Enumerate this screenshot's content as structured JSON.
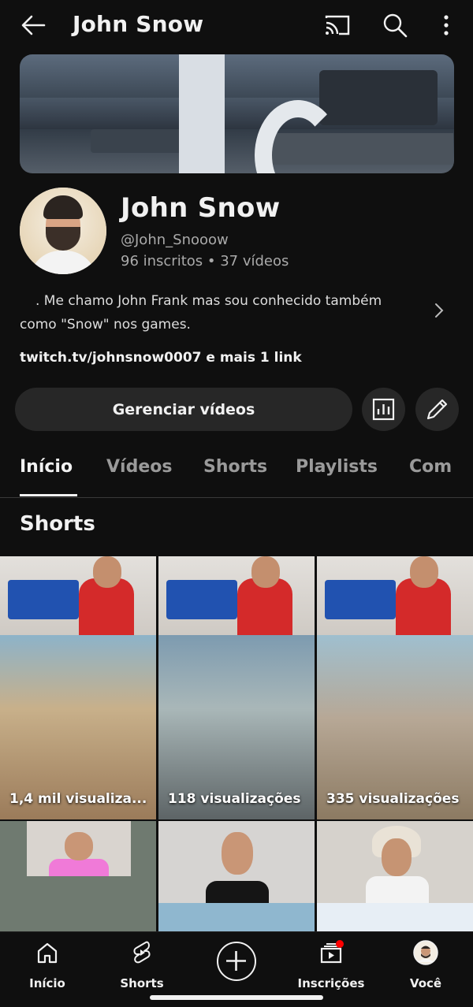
{
  "header": {
    "title": "John Snow",
    "back_icon": "arrow-left-icon",
    "cast_icon": "cast-icon",
    "search_icon": "search-icon",
    "more_icon": "more-vert-icon"
  },
  "channel": {
    "name": "John Snow",
    "handle": "@John_Snooow",
    "stats": "96 inscritos • 37 vídeos",
    "description_line1": ". Me chamo John Frank mas sou conhecido também",
    "description_line2": "como \"Snow\" nos games.",
    "link": "twitch.tv/johnsnow0007 e mais 1 link"
  },
  "actions": {
    "manage_label": "Gerenciar vídeos",
    "analytics_icon": "analytics-icon",
    "edit_icon": "pencil-icon"
  },
  "tabs": [
    {
      "label": "Início"
    },
    {
      "label": "Vídeos"
    },
    {
      "label": "Shorts"
    },
    {
      "label": "Playlists"
    },
    {
      "label": "Com"
    }
  ],
  "section": {
    "title": "Shorts"
  },
  "shorts": [
    {
      "views": "1,4 mil visualiza..."
    },
    {
      "views": "118 visualizações"
    },
    {
      "views": "335 visualizações"
    }
  ],
  "nav": [
    {
      "label": "Início",
      "icon": "home-icon"
    },
    {
      "label": "Shorts",
      "icon": "shorts-icon"
    },
    {
      "label": "",
      "icon": "create-plus-icon"
    },
    {
      "label": "Inscrições",
      "icon": "subscriptions-icon"
    },
    {
      "label": "Você",
      "icon": "profile-avatar-icon"
    }
  ],
  "colors": {
    "background": "#0f0f0f",
    "button": "#272727",
    "notification": "#ff0000"
  }
}
